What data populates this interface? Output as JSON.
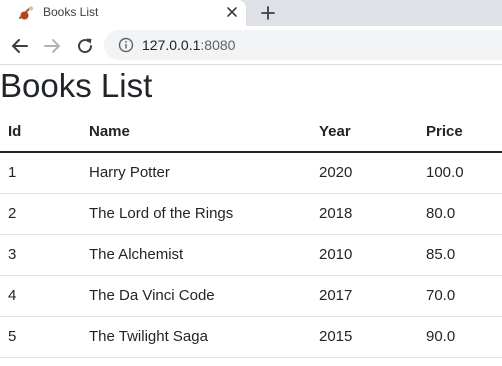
{
  "browser": {
    "tab_title": "Books List",
    "url_host": "127.0.0.1",
    "url_port": ":8080",
    "icons": [
      "favicon-icon",
      "close-icon",
      "plus-icon",
      "back-arrow-icon",
      "forward-arrow-icon",
      "reload-icon",
      "info-icon"
    ]
  },
  "page": {
    "title": "Books List",
    "table": {
      "headers": [
        "Id",
        "Name",
        "Year",
        "Price"
      ],
      "rows": [
        [
          "1",
          "Harry Potter",
          "2020",
          "100.0"
        ],
        [
          "2",
          "The Lord of the Rings",
          "2018",
          "80.0"
        ],
        [
          "3",
          "The Alchemist",
          "2010",
          "85.0"
        ],
        [
          "4",
          "The Da Vinci Code",
          "2017",
          "70.0"
        ],
        [
          "5",
          "The Twilight Saga",
          "2015",
          "90.0"
        ]
      ]
    }
  },
  "colors": {
    "tabstrip": "#dee1e6",
    "omnibox": "#f1f3f4",
    "text": "#212529",
    "row_border": "#dee2e6"
  }
}
